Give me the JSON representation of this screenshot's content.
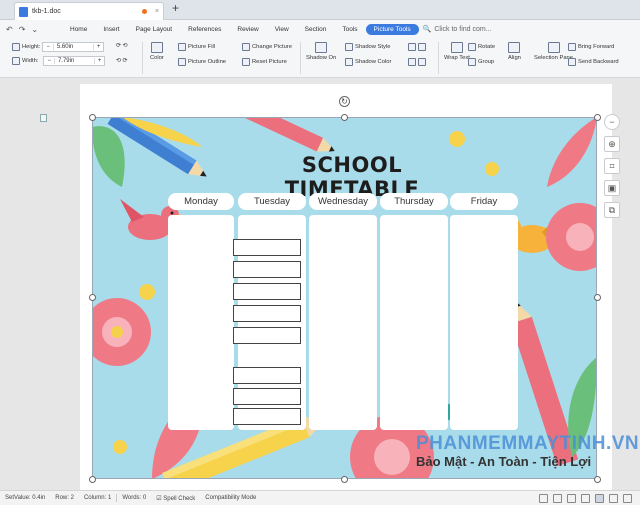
{
  "titlebar": {
    "doc_name": "tkb-1.doc",
    "close": "×",
    "new_tab": "+"
  },
  "menu": {
    "items": [
      "Home",
      "Insert",
      "Page Layout",
      "References",
      "Review",
      "View",
      "Section",
      "Tools"
    ],
    "active": "Picture Tools",
    "find_placeholder": "Click to find com..."
  },
  "ribbon": {
    "height_label": "Height:",
    "height_value": "5.60in",
    "width_label": "Width:",
    "width_value": "7.79in",
    "minus": "−",
    "plus": "+",
    "color": "Color",
    "picture_fill": "Picture Fill",
    "picture_outline": "Picture Outline",
    "change_picture": "Change Picture",
    "reset_picture": "Reset Picture",
    "shadow_on": "Shadow On",
    "shadow_style": "Shadow Style",
    "shadow_color": "Shadow Color",
    "wrap_text": "Wrap Text",
    "rotate": "Rotate",
    "group": "Group",
    "align": "Align",
    "selection_pane": "Selection Pane",
    "bring_forward": "Bring Forward",
    "send_backward": "Send Backward"
  },
  "timetable": {
    "title": "SCHOOL TIMETABLE",
    "days": [
      "Monday",
      "Tuesday",
      "Wednesday",
      "Thursday",
      "Friday"
    ]
  },
  "watermark": {
    "title": "PHANMEMMAYTINH.VN",
    "subtitle": "Bảo Mật - An Toàn - Tiện Lợi"
  },
  "statusbar": {
    "set_value": "SetValue: 0.4in",
    "row": "Row: 2",
    "column": "Column: 1",
    "words": "Words: 0",
    "spell_check": "Spell Check",
    "compat": "Compatibility Mode"
  },
  "colors": {
    "accent": "#3b7be0",
    "picture_bg": "#a9dcea",
    "watermark": "#4b8fd8"
  }
}
